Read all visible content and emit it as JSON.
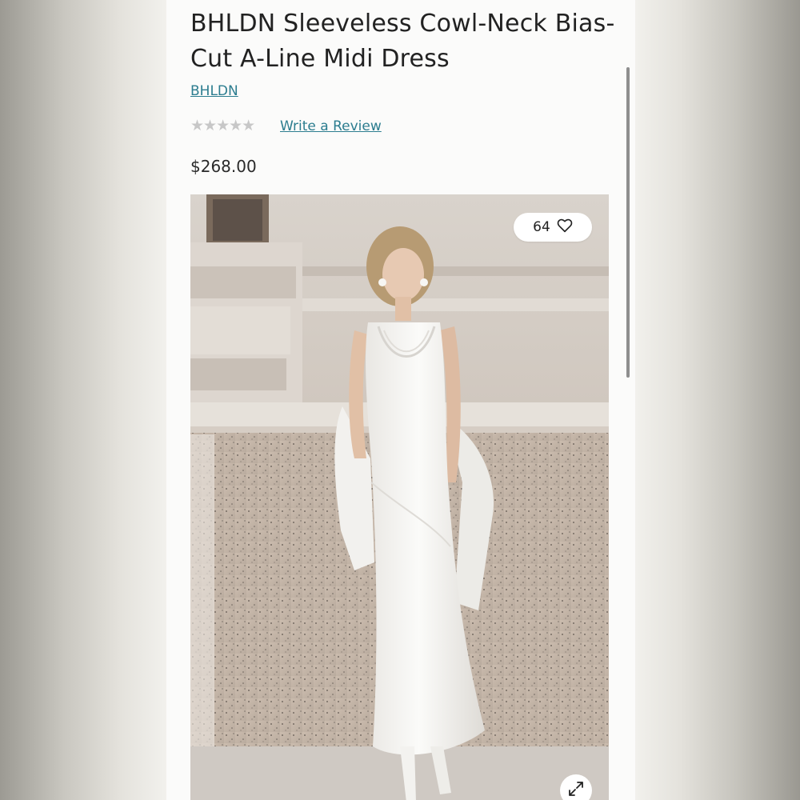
{
  "product": {
    "title": "BHLDN Sleeveless Cowl-Neck Bias-Cut A-Line Midi Dress",
    "brand": "BHLDN",
    "rating_stars": "★★★★★",
    "rating_value": 0,
    "review_link": "Write a Review",
    "price": "$268.00"
  },
  "image": {
    "wishlist_count": "64",
    "wishlist_icon": "heart-icon",
    "expand_icon": "expand-icon",
    "alt": "Model wearing white sleeveless cowl-neck bias-cut midi dress"
  },
  "colors": {
    "link": "#2c7d8f",
    "star_empty": "#c7c7c7",
    "text": "#222222"
  }
}
